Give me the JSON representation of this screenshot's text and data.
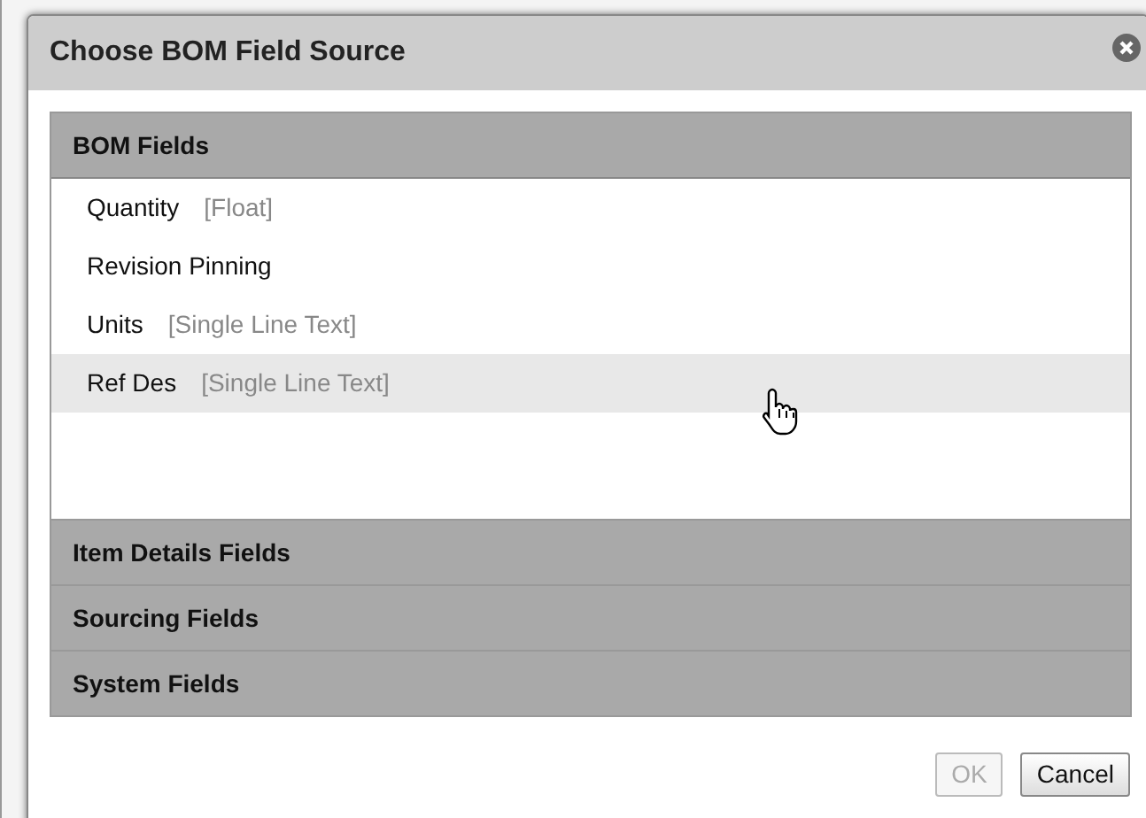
{
  "dialog": {
    "title": "Choose BOM Field Source"
  },
  "sections": [
    {
      "title": "BOM Fields",
      "expanded": true,
      "fields": [
        {
          "name": "Quantity",
          "type": "[Float]",
          "hovered": false
        },
        {
          "name": "Revision Pinning",
          "hovered": false
        },
        {
          "name": "Units",
          "type": "[Single Line Text]",
          "hovered": false
        },
        {
          "name": "Ref Des",
          "type": "[Single Line Text]",
          "hovered": true
        }
      ]
    },
    {
      "title": "Item Details Fields",
      "expanded": false
    },
    {
      "title": "Sourcing Fields",
      "expanded": false
    },
    {
      "title": "System Fields",
      "expanded": false
    }
  ],
  "buttons": [
    {
      "label": "OK",
      "disabled": true
    },
    {
      "label": "Cancel",
      "disabled": false
    }
  ]
}
